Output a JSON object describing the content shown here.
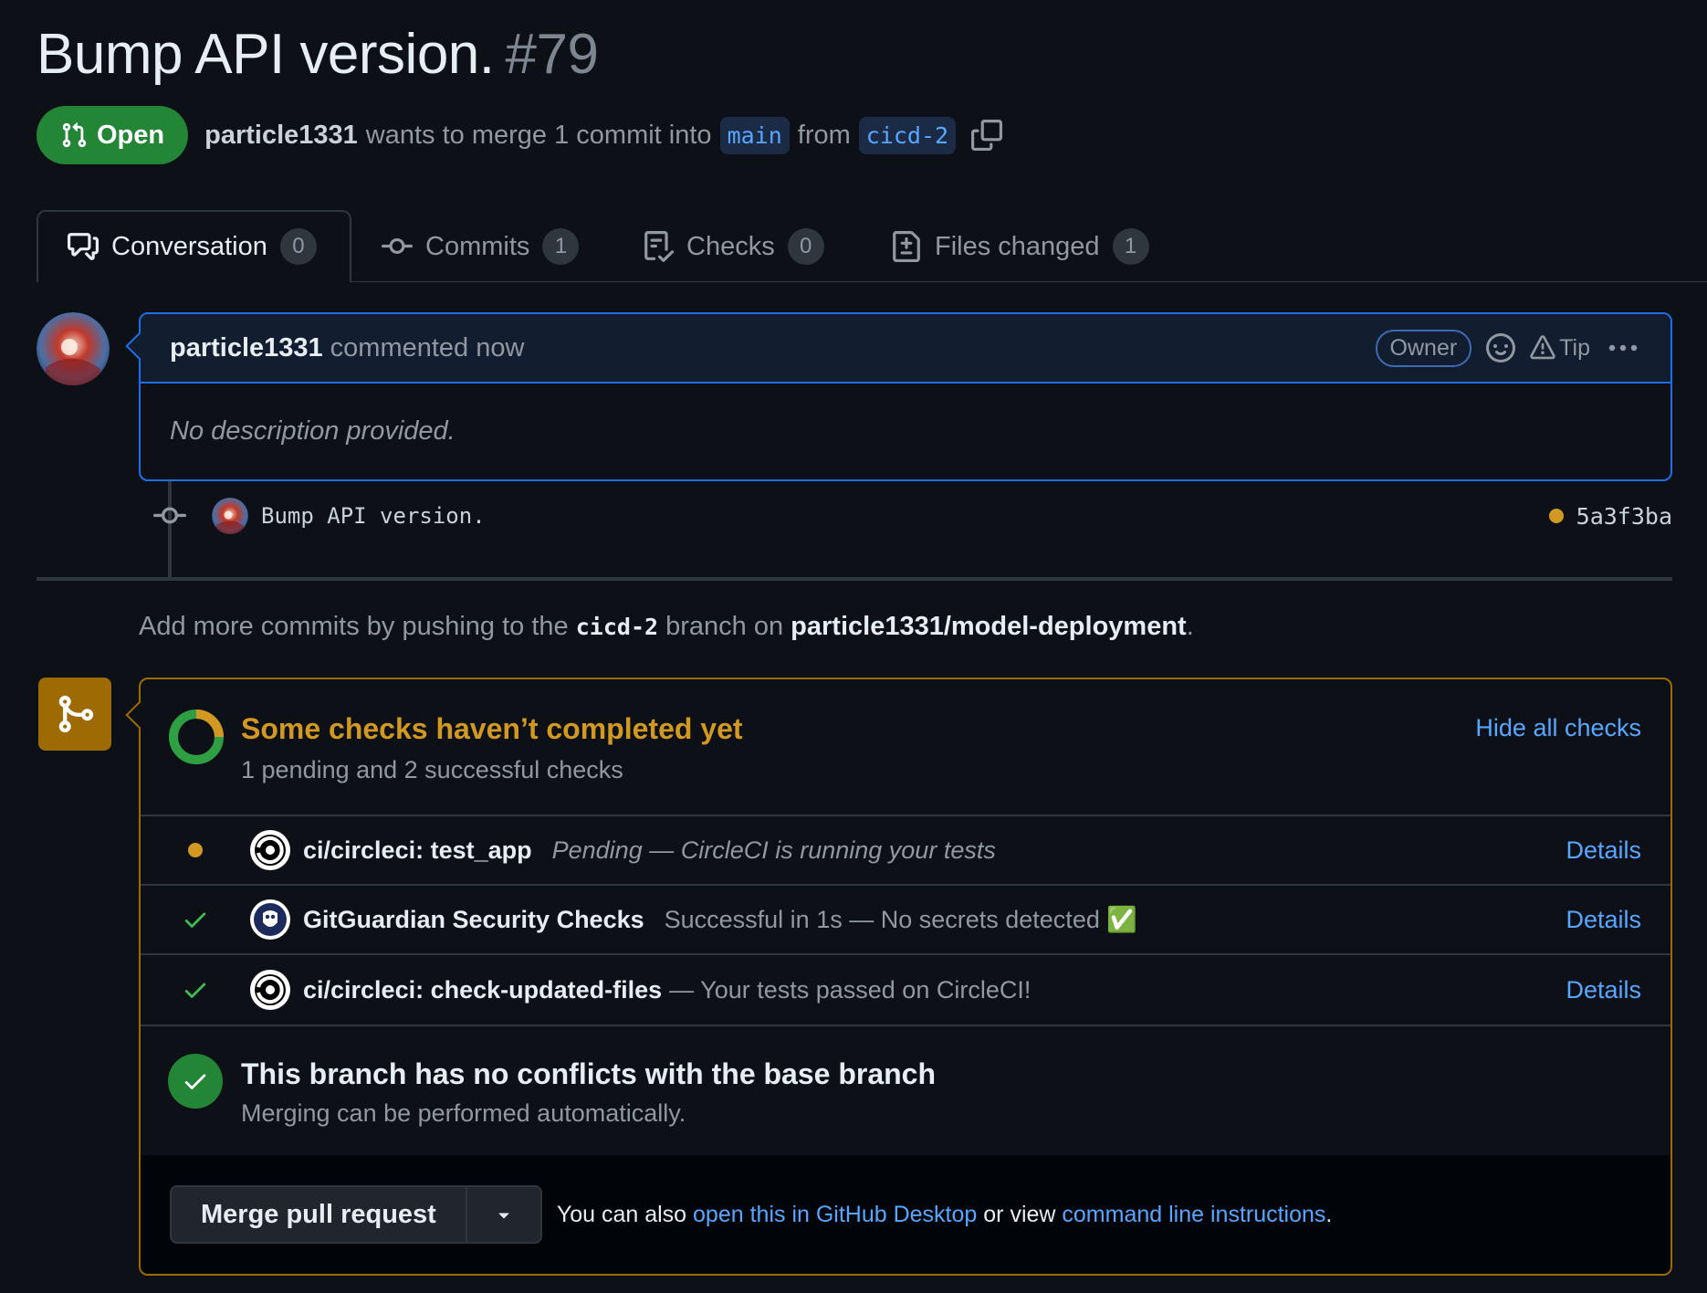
{
  "pr": {
    "title": "Bump API version.",
    "number": "#79",
    "state": "Open",
    "author": "particle1331",
    "merge_text": "wants to merge 1 commit into",
    "base_branch": "main",
    "from_text": "from",
    "head_branch": "cicd-2"
  },
  "tabs": [
    {
      "label": "Conversation",
      "count": "0"
    },
    {
      "label": "Commits",
      "count": "1"
    },
    {
      "label": "Checks",
      "count": "0"
    },
    {
      "label": "Files changed",
      "count": "1"
    }
  ],
  "comment": {
    "author": "particle1331",
    "action": "commented now",
    "badge": "Owner",
    "tip": "Tip",
    "body": "No description provided."
  },
  "commit": {
    "message": "Bump API version.",
    "sha": "5a3f3ba"
  },
  "hint": {
    "prefix": "Add more commits by pushing to the",
    "branch": "cicd-2",
    "middle": "branch on",
    "repo": "particle1331/model-deployment",
    "suffix": "."
  },
  "checks": {
    "title": "Some checks haven’t completed yet",
    "subtitle": "1 pending and 2 successful checks",
    "hide_label": "Hide all checks",
    "items": [
      {
        "name": "ci/circleci: test_app",
        "description": "Pending — CircleCI is running your tests",
        "status": "pending",
        "details": "Details"
      },
      {
        "name": "GitGuardian Security Checks",
        "description": "Successful in 1s — No secrets detected ✅",
        "status": "success",
        "details": "Details"
      },
      {
        "name": "ci/circleci: check-updated-files",
        "description": "— Your tests passed on CircleCI!",
        "status": "success",
        "details": "Details"
      }
    ]
  },
  "conflicts": {
    "title": "This branch has no conflicts with the base branch",
    "subtitle": "Merging can be performed automatically."
  },
  "merge": {
    "button_label": "Merge pull request",
    "text_prefix": "You can also",
    "link_desktop": "open this in GitHub Desktop",
    "text_middle": "or view",
    "link_cli": "command line instructions",
    "text_suffix": "."
  },
  "colors": {
    "background": "#0d1117",
    "open_green": "#238636",
    "pending_amber": "#d29922",
    "link_blue": "#58a6ff",
    "comment_border": "#1f6feb"
  }
}
